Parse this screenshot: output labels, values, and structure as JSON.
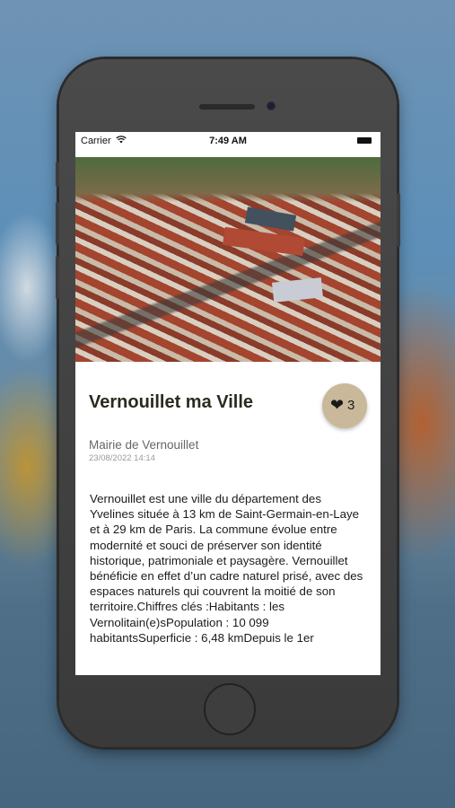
{
  "status_bar": {
    "carrier": "Carrier",
    "time": "7:49 AM"
  },
  "article": {
    "title": "Vernouillet ma Ville",
    "likes": "3",
    "author": "Mairie de Vernouillet",
    "date": "23/08/2022 14:14",
    "body": "Vernouillet est une ville du département des Yvelines située à 13 km de Saint-Germain-en-Laye et à 29 km de Paris. La commune évolue entre modernité et souci de préserver son identité historique, patrimoniale et paysagère. Vernouillet bénéficie en effet d’un cadre naturel prisé, avec des espaces naturels qui couvrent la moitié de son territoire.Chiffres clés :Habitants : les Vernolitain(e)sPopulation : 10 099 habitantsSuperficie : 6,48 kmDepuis le 1er"
  },
  "colors": {
    "like_badge": "#c9b99a",
    "title": "#2c2a1d",
    "phone_frame": "#3f3f3f"
  },
  "icons": {
    "like": "heart-icon",
    "wifi": "wifi-icon",
    "battery": "battery-icon"
  }
}
